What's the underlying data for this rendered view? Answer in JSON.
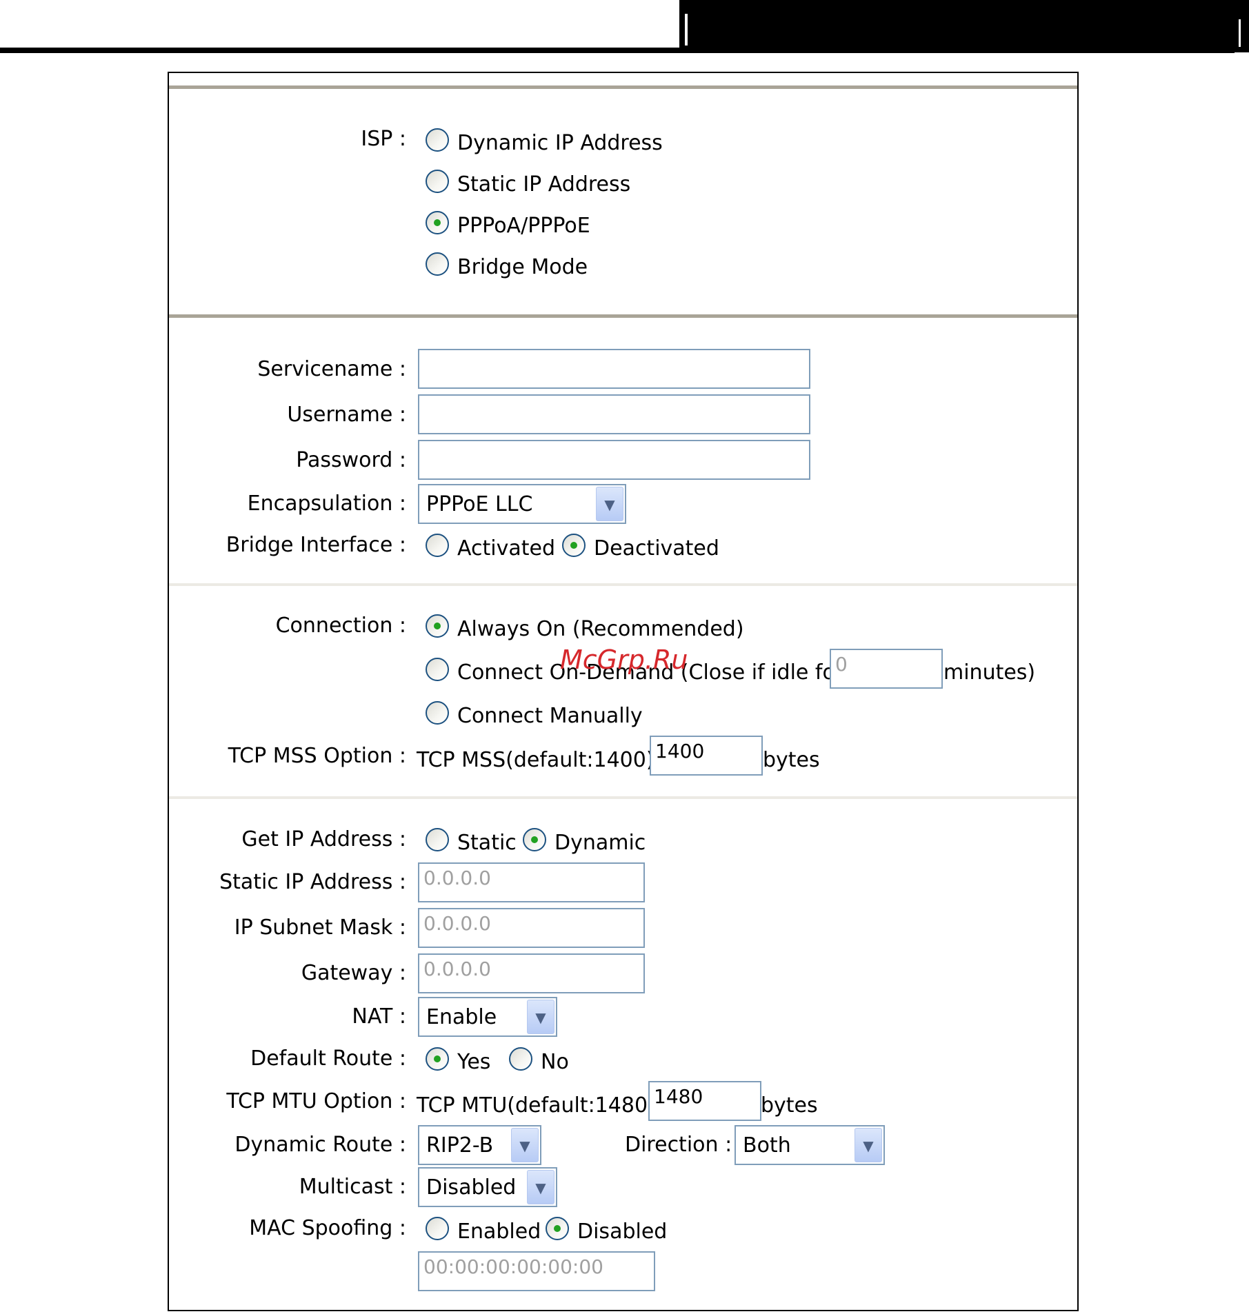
{
  "watermark": "McGrp.Ru",
  "isp": {
    "label": "ISP :",
    "options": [
      "Dynamic IP Address",
      "Static IP Address",
      "PPPoA/PPPoE",
      "Bridge Mode"
    ],
    "selected": "PPPoA/PPPoE"
  },
  "pppoe": {
    "servicename_label": "Servicename :",
    "servicename_value": "",
    "username_label": "Username :",
    "username_value": "",
    "password_label": "Password :",
    "password_value": "",
    "encapsulation_label": "Encapsulation :",
    "encapsulation_value": "PPPoE LLC",
    "bridge_interface_label": "Bridge Interface :",
    "bridge_activated": "Activated",
    "bridge_deactivated": "Deactivated",
    "bridge_selected": "Deactivated"
  },
  "connection": {
    "label": "Connection :",
    "always_on": "Always On (Recommended)",
    "on_demand": "Connect On-Demand (Close if idle for",
    "idle_value": "0",
    "minutes": "minutes)",
    "manual": "Connect Manually",
    "selected": "Always On (Recommended)",
    "tcp_mss_label": "TCP MSS Option :",
    "tcp_mss_text": "TCP MSS(default:1400)",
    "tcp_mss_value": "1400",
    "tcp_mss_unit": "bytes"
  },
  "ip": {
    "get_ip_label": "Get IP Address :",
    "static": "Static",
    "dynamic": "Dynamic",
    "selected": "Dynamic",
    "static_ip_label": "Static IP Address :",
    "static_ip_value": "0.0.0.0",
    "subnet_label": "IP Subnet Mask :",
    "subnet_value": "0.0.0.0",
    "gateway_label": "Gateway :",
    "gateway_value": "0.0.0.0",
    "nat_label": "NAT :",
    "nat_value": "Enable",
    "default_route_label": "Default Route :",
    "yes": "Yes",
    "no": "No",
    "default_route_selected": "Yes",
    "tcp_mtu_label": "TCP MTU Option :",
    "tcp_mtu_text": "TCP MTU(default:1480)",
    "tcp_mtu_value": "1480",
    "tcp_mtu_unit": "bytes",
    "dynamic_route_label": "Dynamic Route :",
    "dynamic_route_value": "RIP2-B",
    "direction_label": "Direction :",
    "direction_value": "Both",
    "multicast_label": "Multicast :",
    "multicast_value": "Disabled",
    "mac_spoofing_label": "MAC Spoofing :",
    "mac_enabled": "Enabled",
    "mac_disabled": "Disabled",
    "mac_selected": "Disabled",
    "mac_value": "00:00:00:00:00:00"
  }
}
